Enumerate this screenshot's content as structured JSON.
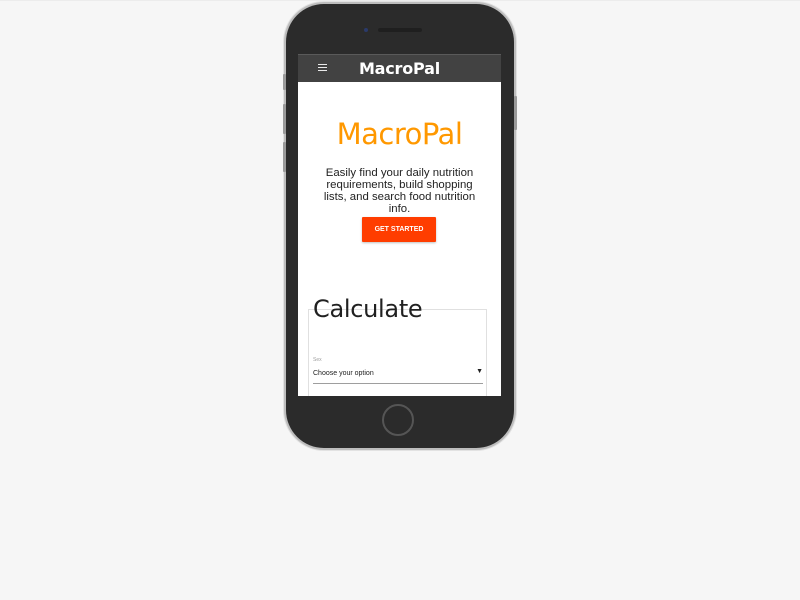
{
  "app": {
    "brand": "MacroPal"
  },
  "navbar": {
    "menu_icon": "hamburger-menu-icon",
    "title": "MacroPal"
  },
  "hero": {
    "title": "MacroPal",
    "description": "Easily find your daily nutrition requirements, build shopping lists, and search food nutrition info.",
    "cta_label": "GET STARTED"
  },
  "calculate": {
    "title": "Calculate",
    "sex_label": "Sex",
    "sex_value": "Choose your option",
    "caret_icon": "▼"
  },
  "colors": {
    "navbar": "#424242",
    "hero_title": "#ff9800",
    "cta": "#ff3d00",
    "background": "#f6f6f6"
  }
}
